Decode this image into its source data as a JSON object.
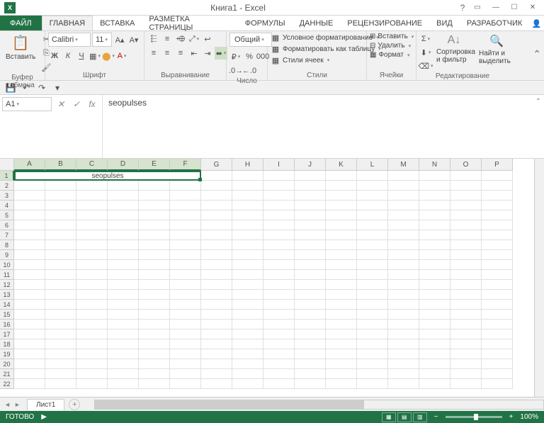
{
  "app": {
    "title": "Книга1 - Excel",
    "icon_text": "X"
  },
  "tabs": {
    "file": "ФАЙЛ",
    "items": [
      "ГЛАВНАЯ",
      "ВСТАВКА",
      "РАЗМЕТКА СТРАНИЦЫ",
      "ФОРМУЛЫ",
      "ДАННЫЕ",
      "РЕЦЕНЗИРОВАНИЕ",
      "ВИД",
      "РАЗРАБОТЧИК"
    ],
    "active_index": 0
  },
  "ribbon": {
    "clipboard": {
      "paste": "Вставить",
      "label": "Буфер обмена"
    },
    "font": {
      "name": "Calibri",
      "size": "11",
      "label": "Шрифт"
    },
    "alignment": {
      "label": "Выравнивание"
    },
    "number": {
      "format": "Общий",
      "label": "Число"
    },
    "styles": {
      "conditional": "Условное форматирование",
      "table": "Форматировать как таблицу",
      "cell": "Стили ячеек",
      "label": "Стили"
    },
    "cells": {
      "insert": "Вставить",
      "delete": "Удалить",
      "format": "Формат",
      "label": "Ячейки"
    },
    "editing": {
      "sort": "Сортировка и фильтр",
      "find": "Найти и выделить",
      "label": "Редактирование"
    }
  },
  "namebox": "A1",
  "formula": "seopulses",
  "columns": [
    "A",
    "B",
    "C",
    "D",
    "E",
    "F",
    "G",
    "H",
    "I",
    "J",
    "K",
    "L",
    "M",
    "N",
    "O",
    "P"
  ],
  "merged_value": "seopulses",
  "sheet": {
    "name": "Лист1"
  },
  "status": {
    "ready": "ГОТОВО",
    "zoom": "100%"
  }
}
